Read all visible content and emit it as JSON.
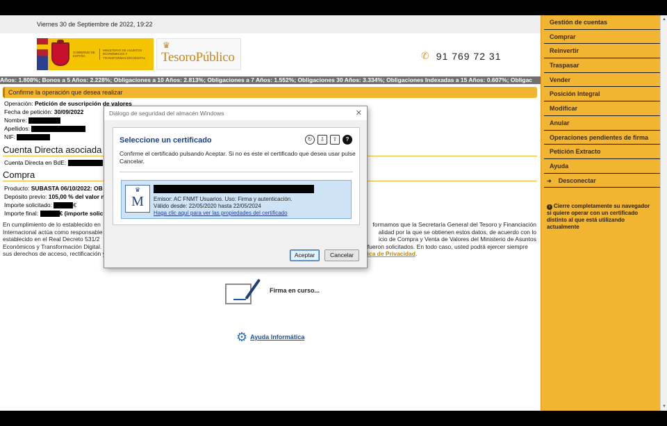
{
  "datebar": {
    "text": "Viernes 30 de Septiembre de 2022, 19:22"
  },
  "header": {
    "gov_text_1": "Gobierno de España",
    "gov_text_2": "Ministerio de Asuntos Económicos y Transformación Digital",
    "tesoro_name": "TesoroPúblico",
    "phone": "91 769 72 31"
  },
  "ticker": {
    "text": "Años: 1.808%; Bonos a 5 Años: 2.228%; Obligaciones a 10 Años: 2.813%; Obligaciones a 7 Años: 1.552%; Obligaciones 30 Años: 3.334%; Obligaciones Indexadas a 15 Años: 0.607%; Obligac"
  },
  "confirm": {
    "text": "Confirme la operación que desea realizar"
  },
  "operation": {
    "operacion_label": "Operación:",
    "operacion_value": "Petición de suscripción de valores",
    "fecha_label": "Fecha de petición:",
    "fecha_value": "30/09/2022",
    "nombre_label": "Nombre:",
    "apellidos_label": "Apellidos:",
    "nif_label": "NIF:"
  },
  "cuenta": {
    "title": "Cuenta Directa asociada",
    "label": "Cuenta Directa en BdE:"
  },
  "compra": {
    "title": "Compra",
    "producto_label": "Producto:",
    "producto_value": "SUBASTA 06/10/2022: OB",
    "deposito_label": "Depósito previo:",
    "deposito_value": "105,00 % del valor n",
    "solicitado_label": "Importe solicitado:",
    "solicitado_suffix": "€",
    "final_label": "Importe final:",
    "final_suffix": "€ (importe solic"
  },
  "legal": {
    "line1_left": "En cumplimiento de lo establecido en",
    "line1_right": "formamos que la Secretaría General del Tesoro y Financiación",
    "line2_left": "Internacional actúa como responsable",
    "line2_right": "alidad por la que se obtienen estos datos, de acuerdo con lo",
    "line3_left": "establecido en el Real Decreto 531/2",
    "line3_right": "icio de Compra y Venta de Valores del Ministerio de Asuntos",
    "line4": "Económicos y Transformación Digital. Que en ningún caso estos datos podrán ser cedidos a Terceros para una finalidad distinta por la que fueron solicitados. En todo caso, usted podrá ejercer siempre",
    "line5_pre": "sus derechos de acceso, rectificación y supresión de estos datos. Para una información más detallada, por favor, acceda al enlace de",
    "link": "Política de Privacidad",
    "line5_post": "."
  },
  "firma": {
    "text": "Firma en curso..."
  },
  "ayuda": {
    "text": "Ayuda Informática"
  },
  "sidebar": {
    "items": [
      "Gestión de cuentas",
      "Comprar",
      "Reinvertir",
      "Traspasar",
      "Vender",
      "Posición Integral",
      "Modificar",
      "Anular",
      "Operaciones pendientes de firma",
      "Petición Extracto",
      "Ayuda",
      "Desconectar"
    ],
    "note": "Cierre completamente su navegador si quiere operar con un certificado distinto al que está utilizando actualmente"
  },
  "dialog": {
    "title": "Diálogo de seguridad del almacén Windows",
    "heading": "Seleccione un certificado",
    "description": "Confirme el certificado pulsando Aceptar. Si no es este el certificado que desea usar pulse Cancelar.",
    "cert_issuer": "Emisor: AC FNMT Usuarios. Uso: Firma y autenticación.",
    "cert_validity": "Válido desde: 22/05/2020 hasta 22/05/2024",
    "cert_link": "Haga clic aquí para ver las propiedades del certificado",
    "accept": "Aceptar",
    "cancel": "Cancelar"
  },
  "colors": {
    "accent": "#f2b532",
    "link_blue": "#1f4f9a",
    "dialog_heading": "#1f3f8a",
    "cert_selected": "#cfe3f7"
  },
  "icons": [
    "phone-icon",
    "gear-icon",
    "close-icon",
    "refresh-icon",
    "import-icon",
    "export-icon",
    "help-icon",
    "logout-arrow-icon",
    "info-icon",
    "signature-pen-icon"
  ]
}
